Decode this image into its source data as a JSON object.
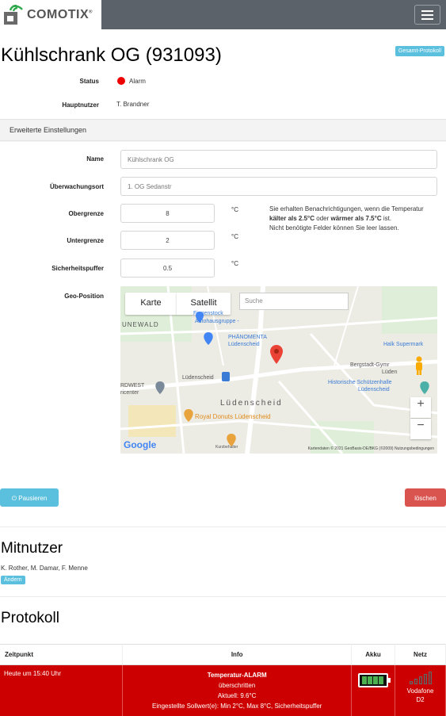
{
  "navbar": {
    "brand": "COMOTIX",
    "brand_mark": "®"
  },
  "header": {
    "title": "Kühlschrank OG (931093)",
    "gesamt_protokoll": "Gesamt-Protokoll"
  },
  "summary": {
    "status_label": "Status",
    "status_value": "Alarm",
    "status_color": "#ee0000",
    "hauptnutzer_label": "Hauptnutzer",
    "hauptnutzer_value": "T. Brandner"
  },
  "settings": {
    "heading": "Erweiterte Einstellungen",
    "name_label": "Name",
    "name_value": "Kühlschrank OG",
    "ort_label": "Überwachungsort",
    "ort_value": "1. OG Sedanstr",
    "ober_label": "Obergrenze",
    "ober_value": "8",
    "ober_unit": "°C",
    "unter_label": "Untergrenze",
    "unter_value": "2",
    "unter_unit": "°C",
    "puffer_label": "Sicherheitspuffer",
    "puffer_value": "0.5",
    "puffer_unit": "°C",
    "hint_1": "Sie erhalten Benachrichtigungen, wenn die Temperatur ",
    "hint_kalter": "kälter als 2.5°C",
    "hint_2": " oder ",
    "hint_warmer": "wärmer als 7.5°C",
    "hint_3": " ist.",
    "hint_4": "Nicht benötigte Felder können Sie leer lassen.",
    "geo_label": "Geo-Position"
  },
  "map": {
    "tab_karte": "Karte",
    "tab_satellit": "Satellit",
    "search_placeholder": "Suche",
    "label_unewald": "UNEWALD",
    "label_fiegenstock": "Fiegenstock",
    "label_autohaus": "Autohausgruppe -",
    "label_phanomenta": "PHÄNOMENTA",
    "label_phanomenta_2": "Lüdenscheid",
    "label_halk": "Halk Supermark",
    "label_bergstadt": "Bergstadt-Gymr",
    "label_bergstadt_2": "Lüden",
    "label_ludenscheid_small": "Lüdenscheid",
    "label_nordwest": "RDWEST",
    "label_nordwest_2": "ricenter",
    "label_ludenscheid_big": "Lüdenscheid",
    "label_historische": "Historische Schützenhalle",
    "label_historische_2": "Lüdenscheid",
    "label_royal": "Royal Donuts Lüdenscheid",
    "label_kurzbehaelter": "Kurzbehälter",
    "zoom_in": "+",
    "zoom_out": "−",
    "google": "Google",
    "footer": "Kartendaten © 2021 GeoBasis-DE/BKG (©2009)   Nutzungsbedingungen"
  },
  "actions": {
    "pause": "Pausieren",
    "delete": "löschen"
  },
  "mitnutzer": {
    "title": "Mitnutzer",
    "names": "K. Rother, M. Damar, F. Menne",
    "andern": "Ändern"
  },
  "protokoll": {
    "title": "Protokoll",
    "columns": [
      "Zeitpunkt",
      "Info",
      "Akku",
      "Netz"
    ],
    "rows": [
      {
        "zeitpunkt": "Heute um 15:40 Uhr",
        "info_title": "Temperatur-ALARM",
        "info_line1": "überschritten",
        "info_line2": "Aktuell: 9.6°C",
        "info_line3": "Eingestellte Sollwert(e): Min 2°C, Max 8°C, Sicherheitspuffer",
        "netz_line1": "Vodafone",
        "netz_line2": "D2"
      }
    ]
  },
  "colors": {
    "alarm_row": "#cc0000",
    "info_button": "#5bc0de",
    "danger_button": "#d9534f",
    "navbar": "#5b626a"
  }
}
